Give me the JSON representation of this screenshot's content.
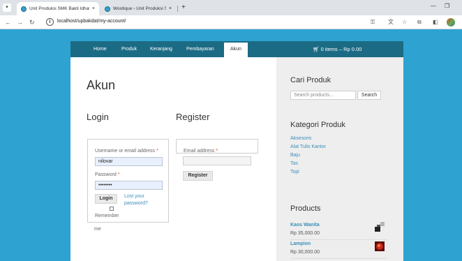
{
  "browser": {
    "tabs": [
      {
        "title": "Unit Produksi SMK Bakti Idhata",
        "close": "×"
      },
      {
        "title": "Wootique › Unit Produksi SMK",
        "close": "×"
      }
    ],
    "new_tab": "+",
    "url": "localhost/upbakdat/my-account/",
    "icons": {
      "info": "i"
    }
  },
  "nav": {
    "items": [
      "Home",
      "Produk",
      "Keranjang",
      "Pembayaran"
    ],
    "active": "Akun",
    "cart": "0 items – Rp 0.00"
  },
  "main": {
    "title": "Akun",
    "login": {
      "heading": "Login",
      "username_label": "Username or email address",
      "username_value": "nilovar",
      "password_label": "Password",
      "password_value": "••••••••",
      "required_mark": "*",
      "login_button": "Login",
      "lost_password_1": "Lost your",
      "lost_password_2": "password?",
      "remember_1": "Remember",
      "remember_2": "me"
    },
    "register": {
      "heading": "Register",
      "email_label": "Email address",
      "register_button": "Register"
    }
  },
  "sidebar": {
    "search_heading": "Cari Produk",
    "search_placeholder": "Search products…",
    "search_button": "Search",
    "categories_heading": "Kategori Produk",
    "categories": [
      "Aksesoris",
      "Alat Tulis Kantor",
      "Baju",
      "Tas",
      "Topi"
    ],
    "products_heading": "Products",
    "products": [
      {
        "name": "Kaos Wanita",
        "price": "Rp 35,000.00"
      },
      {
        "name": "Lampion",
        "price": "Rp 30,000.00"
      }
    ]
  },
  "colors": {
    "page_bg": "#2ea3d2",
    "nav_bg": "#1c6b84",
    "link": "#3b8eb8",
    "required": "#e2401c"
  }
}
